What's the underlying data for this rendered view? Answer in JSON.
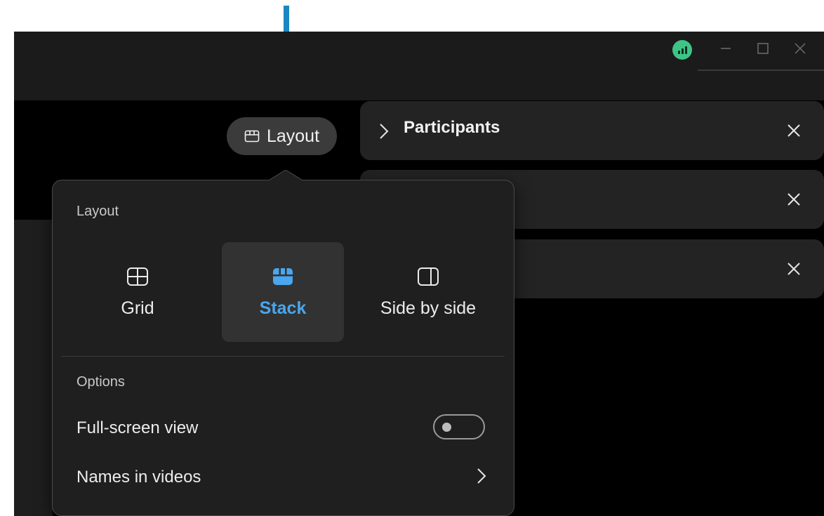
{
  "colors": {
    "annotation_arrow": "#1a87c2",
    "accent_blue": "#4aa6ee",
    "network_indicator": "#3fc488"
  },
  "title_bar": {
    "icons": [
      "network-quality-icon",
      "minimize-icon",
      "maximize-icon",
      "close-icon"
    ]
  },
  "layout_button": {
    "label": "Layout",
    "icon": "layout-icon"
  },
  "side_panels": [
    {
      "title": "Participants",
      "icon": "chevron-right-icon",
      "close_icon": "close-icon"
    },
    {
      "title": "",
      "close_icon": "close-icon"
    },
    {
      "title": "",
      "close_icon": "close-icon"
    }
  ],
  "layout_popover": {
    "heading": "Layout",
    "options": [
      {
        "label": "Grid",
        "icon": "grid-icon",
        "selected": false
      },
      {
        "label": "Stack",
        "icon": "stack-icon",
        "selected": true
      },
      {
        "label": "Side by side",
        "icon": "side-by-side-icon",
        "selected": false
      }
    ],
    "options_heading": "Options",
    "fullscreen": {
      "label": "Full-screen view",
      "enabled": false
    },
    "names_in_videos": {
      "label": "Names in videos",
      "icon": "chevron-right-icon"
    }
  }
}
